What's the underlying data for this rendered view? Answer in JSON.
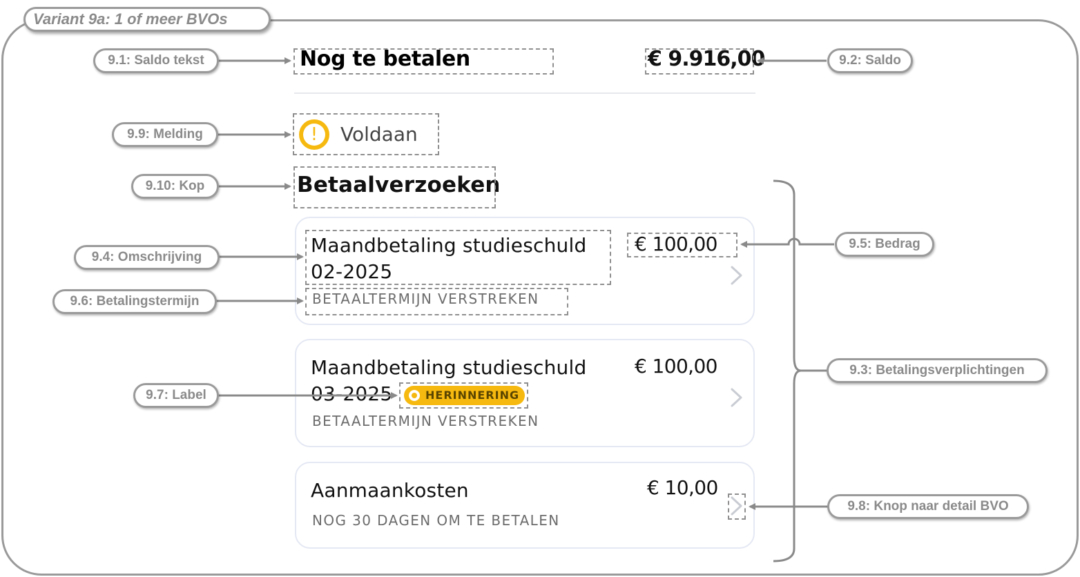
{
  "variant": {
    "title": "Variant 9a: 1 of meer BVOs"
  },
  "balance": {
    "label": "Nog te betalen",
    "amount": "€ 9.916,00"
  },
  "notice": {
    "icon": "warning-circle-icon",
    "text": "Voldaan",
    "color": "#f6b90f"
  },
  "section": {
    "title": "Betaalverzoeken"
  },
  "payments": [
    {
      "line1": "Maandbetaling studieschuld",
      "line2": "02-2025",
      "amount": "€ 100,00",
      "term": "BETAALTERMIJN VERSTREKEN"
    },
    {
      "line1": "Maandbetaling studieschuld",
      "line2": "03-2025",
      "label": "HERINNERING",
      "amount": "€ 100,00",
      "term": "BETAALTERMIJN VERSTREKEN"
    },
    {
      "line1": "Aanmaankosten",
      "amount": "€ 10,00",
      "term": "NOG 30 DAGEN OM TE BETALEN"
    }
  ],
  "annotations": {
    "saldo_tekst": "9.1: Saldo tekst",
    "saldo": "9.2: Saldo",
    "betalingsverplichtingen": "9.3: Betalingsverplichtingen",
    "omschrijving": "9.4: Omschrijving",
    "bedrag": "9.5: Bedrag",
    "betalingstermijn": "9.6: Betalingstermijn",
    "label": "9.7: Label",
    "knop": "9.8: Knop naar detail BVO",
    "melding": "9.9: Melding",
    "kop": "9.10: Kop"
  },
  "colors": {
    "accent": "#f6b90f",
    "annotation": "#9a9a9a",
    "card_border": "#e4e8f3"
  }
}
